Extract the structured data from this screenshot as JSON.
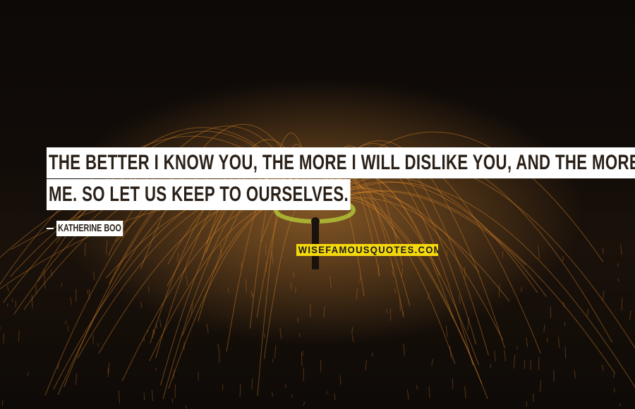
{
  "quote": {
    "line1": "THE BETTER I KNOW YOU, THE MORE I WILL DISLIKE YOU, AND THE MORE YOU WILL DISLIKE",
    "line2": "ME. SO LET US KEEP TO OURSELVES."
  },
  "author": "KATHERINE BOO",
  "watermark": "WISEFAMOUSQUOTES.COM",
  "colors": {
    "label_background": "#ffffff",
    "label_text": "#2a2018",
    "watermark_background": "#f5d80c",
    "spark": "#e08a2a",
    "halo": "#b8d23a"
  }
}
